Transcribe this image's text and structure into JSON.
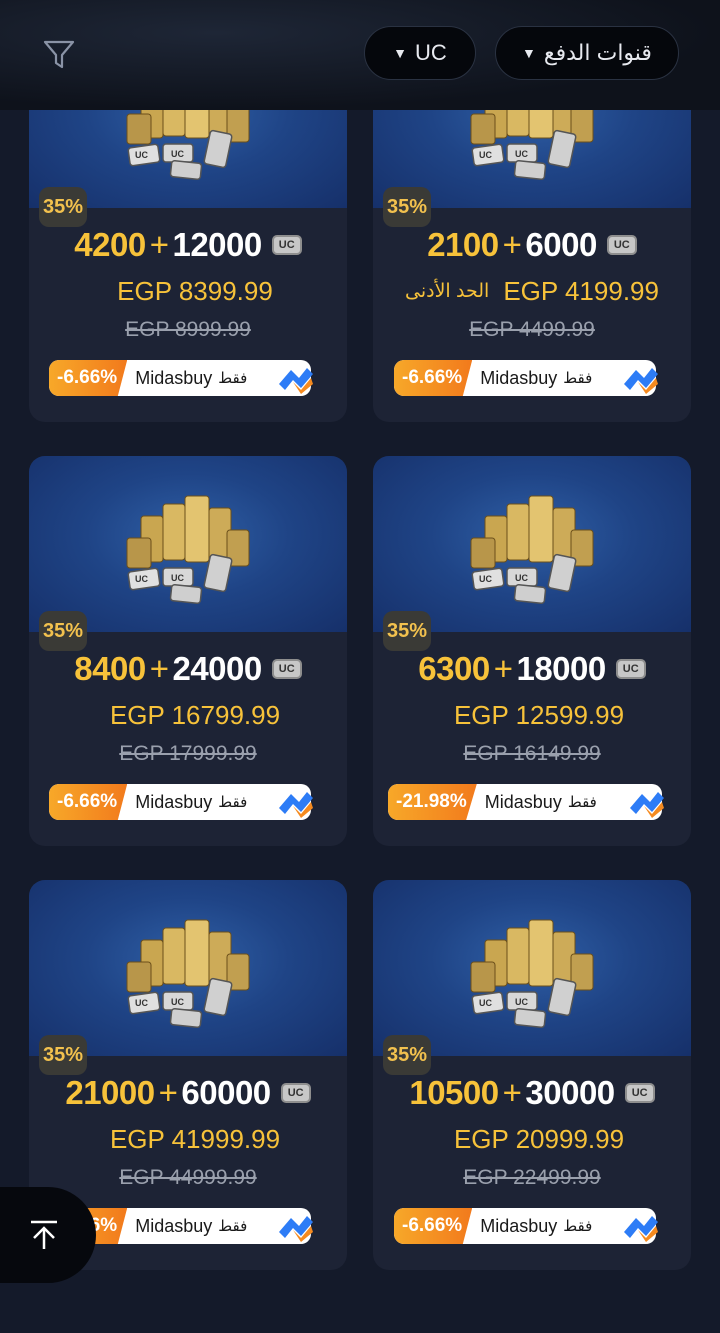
{
  "header": {
    "filter_icon": "filter-icon",
    "currency_label": "UC",
    "payment_label": "قنوات الدفع"
  },
  "cards": [
    {
      "bonus_pct": "35%",
      "bonus_uc": "4200",
      "plus": "+",
      "base_uc": "12000",
      "price": "EGP 8399.99",
      "min_label": "",
      "old_price": "EGP 8999.99",
      "discount": "-6.66%",
      "brand": "Midasbuy",
      "only": "فقط"
    },
    {
      "bonus_pct": "35%",
      "bonus_uc": "2100",
      "plus": "+",
      "base_uc": "6000",
      "price": "EGP 4199.99",
      "min_label": "الحد الأدنى",
      "old_price": "EGP 4499.99",
      "discount": "-6.66%",
      "brand": "Midasbuy",
      "only": "فقط"
    },
    {
      "bonus_pct": "35%",
      "bonus_uc": "8400",
      "plus": "+",
      "base_uc": "24000",
      "price": "EGP 16799.99",
      "min_label": "",
      "old_price": "EGP 17999.99",
      "discount": "-6.66%",
      "brand": "Midasbuy",
      "only": "فقط"
    },
    {
      "bonus_pct": "35%",
      "bonus_uc": "6300",
      "plus": "+",
      "base_uc": "18000",
      "price": "EGP 12599.99",
      "min_label": "",
      "old_price": "EGP 16149.99",
      "discount": "-21.98%",
      "brand": "Midasbuy",
      "only": "فقط"
    },
    {
      "bonus_pct": "35%",
      "bonus_uc": "21000",
      "plus": "+",
      "base_uc": "60000",
      "price": "EGP 41999.99",
      "min_label": "",
      "old_price": "EGP 44999.99",
      "discount": "-6.66%",
      "brand": "Midasbuy",
      "only": "فقط"
    },
    {
      "bonus_pct": "35%",
      "bonus_uc": "10500",
      "plus": "+",
      "base_uc": "30000",
      "price": "EGP 20999.99",
      "min_label": "",
      "old_price": "EGP 22499.99",
      "discount": "-6.66%",
      "brand": "Midasbuy",
      "only": "فقط"
    }
  ],
  "uc_icon_text": "UC",
  "scroll_top_icon": "arrow-up-to-top-icon",
  "colors": {
    "gold": "#f7c23a",
    "card_bg": "#1d2335",
    "page_bg": "#141a2a",
    "orange": "#f27a1c"
  }
}
